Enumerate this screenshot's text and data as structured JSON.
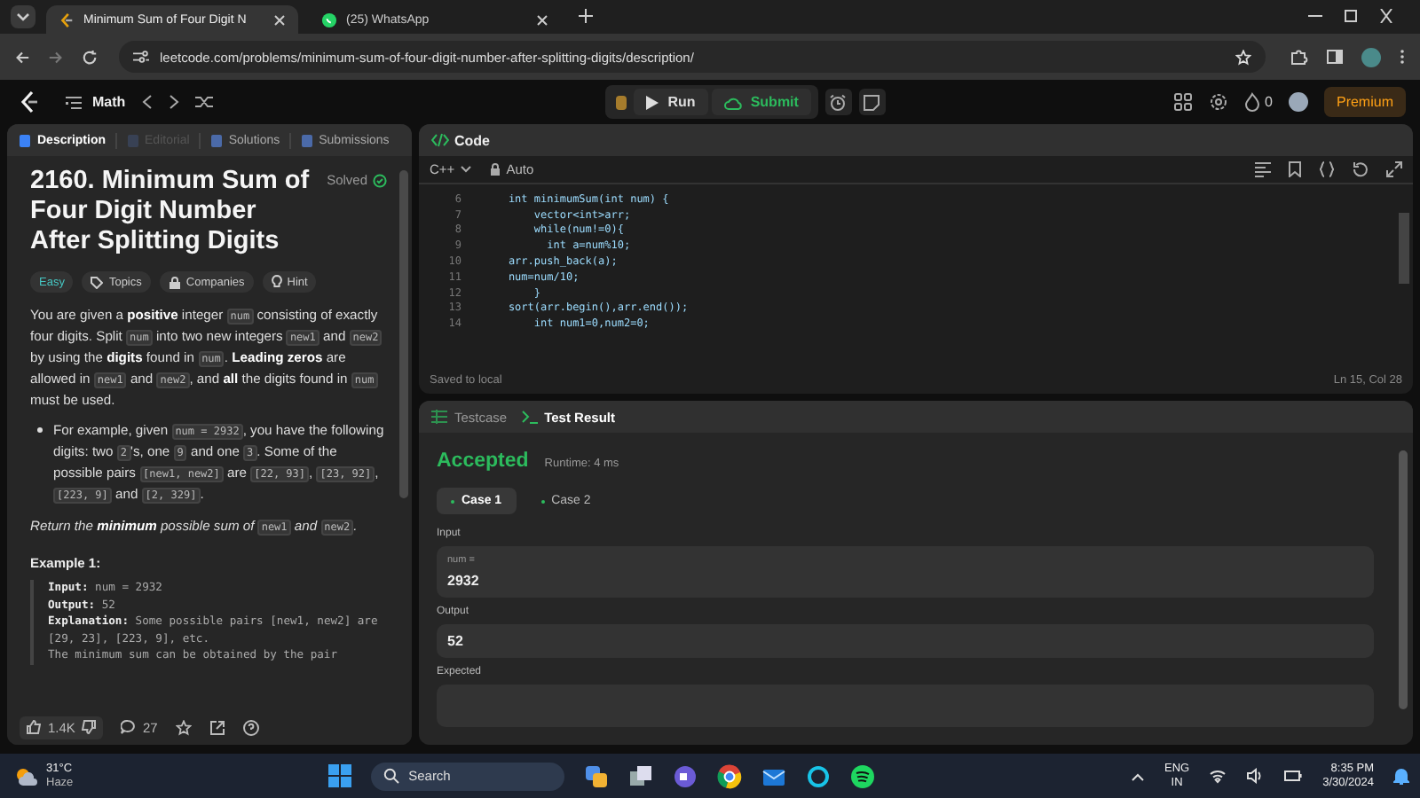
{
  "browser": {
    "tabs": [
      {
        "title": "Minimum Sum of Four Digit N",
        "selected": true,
        "kind": "leetcode"
      },
      {
        "title": "(25) WhatsApp",
        "selected": false,
        "kind": "whatsapp"
      }
    ],
    "url": "leetcode.com/problems/minimum-sum-of-four-digit-number-after-splitting-digits/description/"
  },
  "nav": {
    "list": "Math",
    "run": "Run",
    "submit": "Submit",
    "streak": "0",
    "premium": "Premium"
  },
  "description": {
    "tabs": [
      {
        "label": "Description",
        "selected": true,
        "disabled": false
      },
      {
        "label": "Editorial",
        "selected": false,
        "disabled": true
      },
      {
        "label": "Solutions",
        "selected": false,
        "disabled": false
      },
      {
        "label": "Submissions",
        "selected": false,
        "disabled": false
      }
    ],
    "title": "2160. Minimum Sum of Four Digit Number After Splitting Digits",
    "status": "Solved",
    "tags": [
      {
        "label": "Easy",
        "kind": "difficulty"
      },
      {
        "label": "Topics",
        "kind": "topics"
      },
      {
        "label": "Companies",
        "kind": "companies"
      },
      {
        "label": "Hint",
        "kind": "hint"
      }
    ],
    "paragraph": [
      {
        "t": "You are given a ",
        "kind": "text"
      },
      {
        "t": "positive",
        "kind": "bold"
      },
      {
        "t": " integer ",
        "kind": "text"
      },
      {
        "t": "num",
        "kind": "code"
      },
      {
        "t": " consisting of exactly four digits. Split ",
        "kind": "text"
      },
      {
        "t": "num",
        "kind": "code"
      },
      {
        "t": " into two new integers ",
        "kind": "text"
      },
      {
        "t": "new1",
        "kind": "code"
      },
      {
        "t": " and ",
        "kind": "text"
      },
      {
        "t": "new2",
        "kind": "code"
      },
      {
        "t": " by using the ",
        "kind": "text"
      },
      {
        "t": "digits",
        "kind": "bold"
      },
      {
        "t": " found in ",
        "kind": "text"
      },
      {
        "t": "num",
        "kind": "code"
      },
      {
        "t": ". ",
        "kind": "text"
      },
      {
        "t": "Leading zeros",
        "kind": "bold"
      },
      {
        "t": " are allowed in ",
        "kind": "text"
      },
      {
        "t": "new1",
        "kind": "code"
      },
      {
        "t": " and ",
        "kind": "text"
      },
      {
        "t": "new2",
        "kind": "code"
      },
      {
        "t": ", and ",
        "kind": "text"
      },
      {
        "t": "all",
        "kind": "bold"
      },
      {
        "t": " the digits found in ",
        "kind": "text"
      },
      {
        "t": "num",
        "kind": "code"
      },
      {
        "t": " must be used.",
        "kind": "text"
      }
    ],
    "bullet": [
      {
        "t": "For example, given ",
        "kind": "text"
      },
      {
        "t": "num = 2932",
        "kind": "code"
      },
      {
        "t": ", you have the following digits: two ",
        "kind": "text"
      },
      {
        "t": "2",
        "kind": "code"
      },
      {
        "t": "'s, one ",
        "kind": "text"
      },
      {
        "t": "9",
        "kind": "code"
      },
      {
        "t": " and one ",
        "kind": "text"
      },
      {
        "t": "3",
        "kind": "code"
      },
      {
        "t": ". Some of the possible pairs ",
        "kind": "text"
      },
      {
        "t": "[new1, new2]",
        "kind": "code"
      },
      {
        "t": " are ",
        "kind": "text"
      },
      {
        "t": "[22, 93]",
        "kind": "code"
      },
      {
        "t": ", ",
        "kind": "text"
      },
      {
        "t": "[23, 92]",
        "kind": "code"
      },
      {
        "t": ", ",
        "kind": "text"
      },
      {
        "t": "[223, 9]",
        "kind": "code"
      },
      {
        "t": " and ",
        "kind": "text"
      },
      {
        "t": "[2, 329]",
        "kind": "code"
      },
      {
        "t": ".",
        "kind": "text"
      }
    ],
    "return": [
      {
        "t": "Return the ",
        "kind": "italic"
      },
      {
        "t": "minimum",
        "kind": "bolditalic"
      },
      {
        "t": " possible sum of ",
        "kind": "italic"
      },
      {
        "t": "new1",
        "kind": "code"
      },
      {
        "t": " and ",
        "kind": "italic"
      },
      {
        "t": "new2",
        "kind": "code"
      },
      {
        "t": ".",
        "kind": "italic"
      }
    ],
    "example_title": "Example 1:",
    "example": [
      "**Input:** num = 2932",
      "**Output:** 52",
      "**Explanation:** Some possible pairs [new1, new2] are [29, 23], [223, 9], etc.",
      "The minimum sum can be obtained by the pair"
    ],
    "likes": "1.4K",
    "comments": "27"
  },
  "code": {
    "title": "Code",
    "language": "C++",
    "mode": "Auto",
    "lines": [
      {
        "n": "6",
        "t": "    int minimumSum(int num) {"
      },
      {
        "n": "7",
        "t": "        vector<int>arr;"
      },
      {
        "n": "8",
        "t": "        while(num!=0){"
      },
      {
        "n": "9",
        "t": "          int a=num%10;"
      },
      {
        "n": "10",
        "t": "    arr.push_back(a);"
      },
      {
        "n": "11",
        "t": "    num=num/10;"
      },
      {
        "n": "12",
        "t": "        }"
      },
      {
        "n": "13",
        "t": "    sort(arr.begin(),arr.end());"
      },
      {
        "n": "14",
        "t": "        int num1=0,num2=0;"
      }
    ],
    "saved": "Saved to local",
    "cursor": "Ln 15, Col 28"
  },
  "tests": {
    "tabs": [
      {
        "label": "Testcase",
        "selected": false
      },
      {
        "label": "Test Result",
        "selected": true
      }
    ],
    "verdict": "Accepted",
    "runtime": "Runtime: 4 ms",
    "cases": [
      {
        "label": "Case 1",
        "selected": true
      },
      {
        "label": "Case 2",
        "selected": false
      }
    ],
    "input_label": "Input",
    "input_name": "num =",
    "input_value": "2932",
    "output_label": "Output",
    "output_value": "52",
    "expected_label": "Expected"
  },
  "taskbar": {
    "temp": "31°C",
    "weather": "Haze",
    "search": "Search",
    "lang": "ENG",
    "region": "IN",
    "time": "8:35 PM",
    "date": "3/30/2024"
  }
}
